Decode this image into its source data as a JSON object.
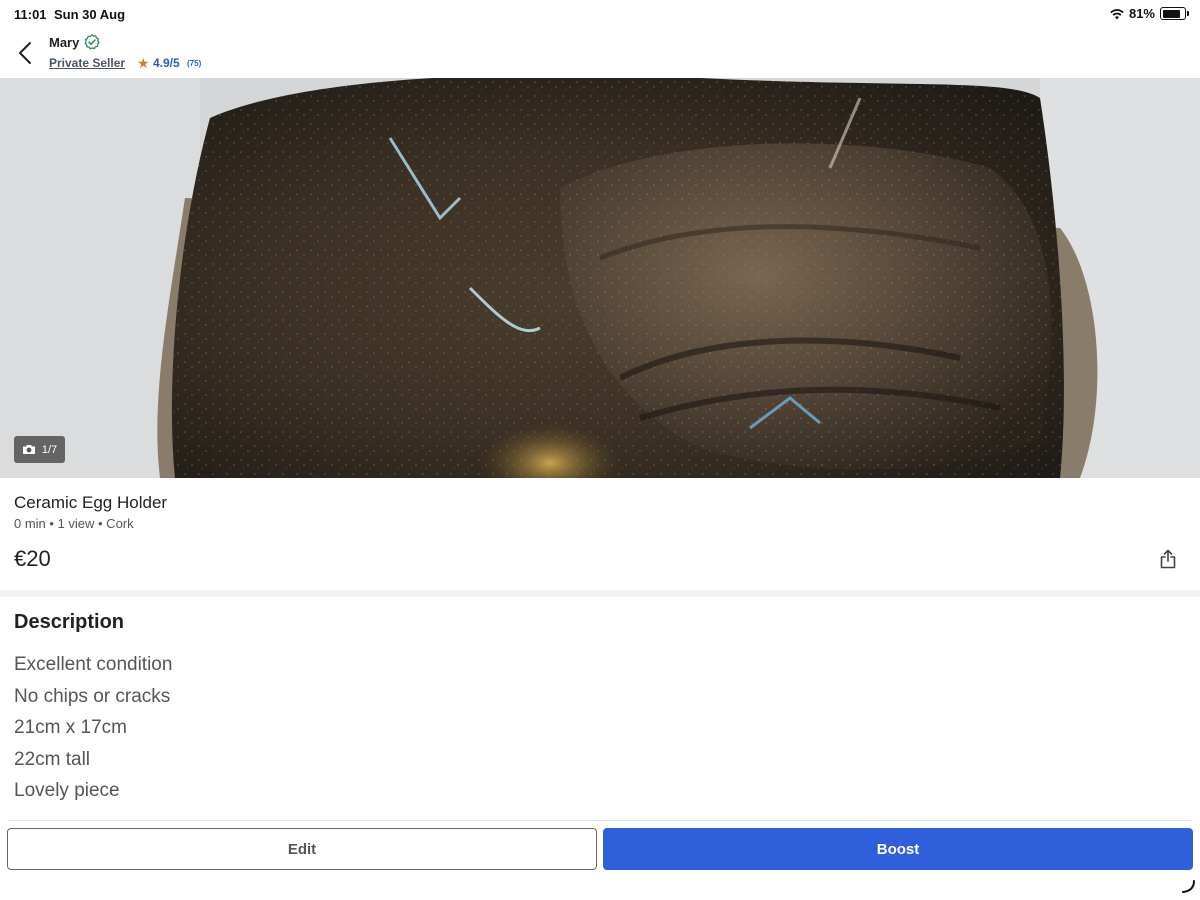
{
  "status_bar": {
    "time": "11:01",
    "date": "Sun 30 Aug",
    "battery": "81%",
    "battery_level": 0.81,
    "icons": [
      "wifi-icon",
      "battery-icon"
    ]
  },
  "header": {
    "back_icon": "chevron-left-icon",
    "seller_name": "Mary",
    "verified_icon": "verified-check-icon",
    "seller_type": "Private Seller",
    "rating": "4.9/5",
    "rating_count": "(75)",
    "star_icon": "★"
  },
  "photo": {
    "counter": "1/7",
    "counter_icon": "camera-icon"
  },
  "listing": {
    "title": "Ceramic Egg Holder",
    "meta": "0 min • 1 view • Cork",
    "price": "€20",
    "share_icon": "share-icon"
  },
  "description": {
    "heading": "Description",
    "lines": [
      "Excellent condition",
      "No chips or cracks",
      "21cm x 17cm",
      "22cm tall",
      "Lovely piece"
    ]
  },
  "actions": {
    "edit_label": "Edit",
    "boost_label": "Boost"
  },
  "colors": {
    "accent": "#2f5fdb",
    "rating": "#2b5bb8",
    "star": "#e07a1f",
    "verified": "#2e8b57"
  }
}
